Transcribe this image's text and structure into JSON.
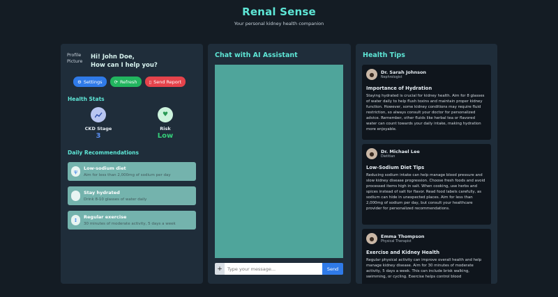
{
  "header": {
    "title": "Renal Sense",
    "subtitle": "Your personal kidney health companion"
  },
  "profile": {
    "image_alt_line1": "Profile",
    "image_alt_line2": "Picture",
    "greeting_line1": "Hi! John Doe,",
    "greeting_line2": "How can I help you?"
  },
  "buttons": {
    "settings": "Settings",
    "settings_icon": "gear-icon",
    "refresh": "Refresh",
    "refresh_icon": "refresh-icon",
    "report": "Send Report",
    "report_icon": "document-icon"
  },
  "health_stats": {
    "title": "Health Stats",
    "ckd": {
      "label": "CKD Stage",
      "value": "3",
      "icon": "chart-icon"
    },
    "risk": {
      "label": "Risk",
      "value": "Low",
      "icon": "heart-icon"
    }
  },
  "recommendations": {
    "title": "Daily Recommendations",
    "items": [
      {
        "name": "Low-sodium diet",
        "desc": "Aim for less than 2,000mg of sodium per day",
        "icon": "utensils-icon"
      },
      {
        "name": "Stay hydrated",
        "desc": "Drink 8-10 glasses of water daily",
        "icon": "water-glass-icon"
      },
      {
        "name": "Regular exercise",
        "desc": "30 minutes of moderate activity, 5 days a week",
        "icon": "dumbbell-icon"
      }
    ]
  },
  "chat": {
    "title": "Chat with AI Assistant",
    "plus": "+",
    "placeholder": "Type your message...",
    "send": "Send"
  },
  "tips": {
    "title": "Health Tips",
    "items": [
      {
        "name": "Dr. Sarah Johnson",
        "role": "Nephrologist",
        "heading": "Importance of Hydration",
        "text": "Staying hydrated is crucial for kidney health. Aim for 8 glasses of water daily to help flush toxins and maintain proper kidney function. However, some kidney conditions may require fluid restriction, so always consult your doctor for personalized advice. Remember, other fluids like herbal tea or flavored water can count towards your daily intake, making hydration more enjoyable."
      },
      {
        "name": "Dr. Michael Lee",
        "role": "Dietitian",
        "heading": "Low-Sodium Diet Tips",
        "text": "Reducing sodium intake can help manage blood pressure and slow kidney disease progression. Choose fresh foods and avoid processed items high in salt. When cooking, use herbs and spices instead of salt for flavor. Read food labels carefully, as sodium can hide in unexpected places. Aim for less than 2,000mg of sodium per day, but consult your healthcare provider for personalized recommendations."
      },
      {
        "name": "Emma Thompson",
        "role": "Physical Therapist",
        "heading": "Exercise and Kidney Health",
        "text": "Regular physical activity can improve overall health and help manage kidney disease. Aim for 30 minutes of moderate activity, 5 days a week. This can include brisk walking, swimming, or cycling. Exercise helps control blood"
      }
    ]
  }
}
